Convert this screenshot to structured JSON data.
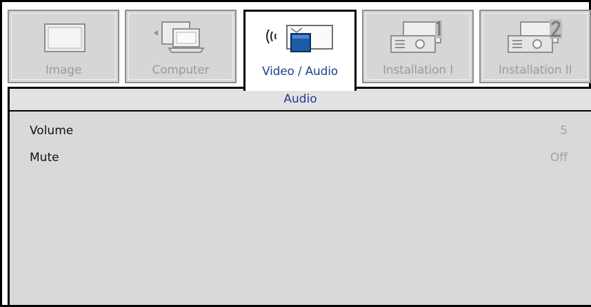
{
  "tabs": [
    {
      "label": "Image",
      "icon": "monitor-icon",
      "active": false
    },
    {
      "label": "Computer",
      "icon": "laptop-icon",
      "active": false
    },
    {
      "label": "Video / Audio",
      "icon": "video-audio-icon",
      "active": true
    },
    {
      "label": "Installation I",
      "icon": "projector-1-icon",
      "active": false
    },
    {
      "label": "Installation II",
      "icon": "projector-2-icon",
      "active": false
    }
  ],
  "section": {
    "title": "Audio"
  },
  "settings": [
    {
      "name": "Volume",
      "value": "5"
    },
    {
      "name": "Mute",
      "value": "Off"
    }
  ],
  "colors": {
    "accent": "#1d3f8f",
    "tab_inactive_bg": "#d6d6d6",
    "panel_bg": "#d9d9d9",
    "value_text": "#a3a3a3"
  }
}
